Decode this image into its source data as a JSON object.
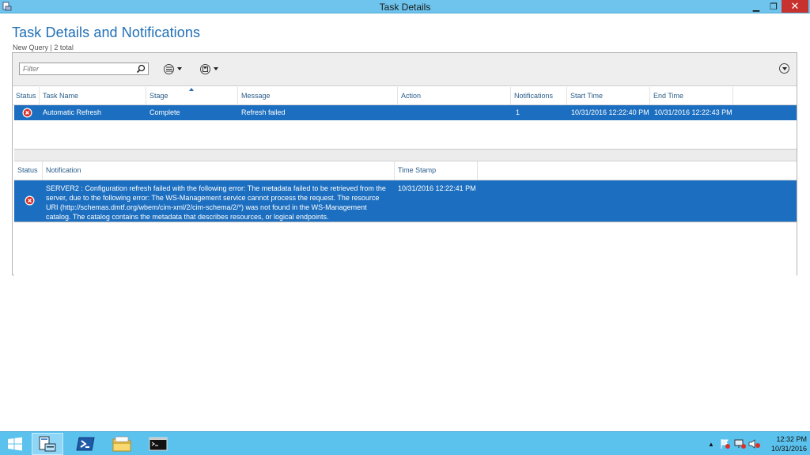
{
  "window": {
    "title": "Task Details"
  },
  "header": {
    "title": "Task Details and Notifications",
    "subtitle": "New Query | 2 total"
  },
  "toolbar": {
    "filter_placeholder": "Filter"
  },
  "tasks": {
    "columns": [
      "Status",
      "Task Name",
      "Stage",
      "Message",
      "Action",
      "Notifications",
      "Start Time",
      "End Time"
    ],
    "rows": [
      {
        "status": "error",
        "task_name": "Automatic Refresh",
        "stage": "Complete",
        "message": "Refresh failed",
        "action": "",
        "notifications": "1",
        "start_time": "10/31/2016 12:22:40 PM",
        "end_time": "10/31/2016 12:22:43 PM"
      }
    ]
  },
  "notifications": {
    "columns": [
      "Status",
      "Notification",
      "Time Stamp"
    ],
    "rows": [
      {
        "status": "error",
        "message": "SERVER2 : Configuration refresh failed with the following error: The metadata failed to be retrieved from the server, due to the following error: The WS-Management service cannot process the request. The resource URI (http://schemas.dmtf.org/wbem/cim-xml/2/cim-schema/2/*) was not found in the WS-Management catalog. The catalog contains the metadata that describes resources, or logical endpoints.",
        "timestamp": "10/31/2016 12:22:41 PM"
      }
    ]
  },
  "taskbar": {
    "items": [
      "start-icon",
      "server-manager-icon",
      "powershell-icon",
      "file-explorer-icon",
      "command-prompt-icon"
    ],
    "clock_time": "12:32 PM",
    "clock_date": "10/31/2016"
  },
  "colors": {
    "titlebar": "#6ec4ec",
    "selection": "#1c6fc0",
    "taskbar": "#5bc2ee",
    "close": "#c7312e",
    "heading": "#1f6fb6"
  }
}
